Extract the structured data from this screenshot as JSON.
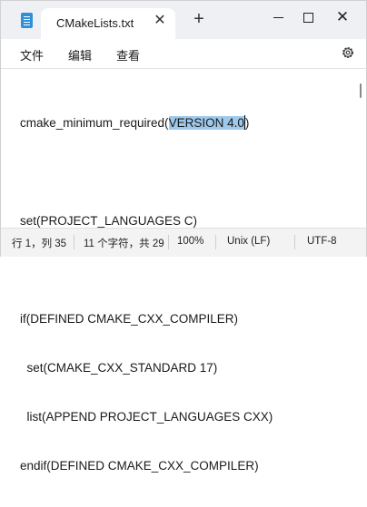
{
  "titlebar": {
    "tab_title": "CMakeLists.txt",
    "tab_close": "✕",
    "new_tab": "+",
    "close": "✕"
  },
  "menu": {
    "items": [
      "文件",
      "编辑",
      "查看"
    ]
  },
  "editor": {
    "lines": [
      {
        "pre": "cmake_minimum_required(",
        "selected": "VERSION 4.0",
        "post": ")"
      },
      {
        "text": ""
      },
      {
        "text": "set(PROJECT_LANGUAGES C)"
      },
      {
        "text": ""
      },
      {
        "text": "if(DEFINED CMAKE_CXX_COMPILER)"
      },
      {
        "text": "  set(CMAKE_CXX_STANDARD 17)"
      },
      {
        "text": "  list(APPEND PROJECT_LANGUAGES CXX)"
      },
      {
        "text": "endif(DEFINED CMAKE_CXX_COMPILER)"
      }
    ]
  },
  "status": {
    "position": "行 1，列 35",
    "selection": "11 个字符，共 29",
    "zoom": "100%",
    "line_ending": "Unix (LF)",
    "encoding": "UTF-8"
  },
  "colors": {
    "selection": "#9ec9ec",
    "titlebar": "#eef0f3",
    "statusbar": "#f3f3f3"
  },
  "icons": [
    "notepad-app-icon",
    "close-icon",
    "plus-icon",
    "minimize-icon",
    "maximize-icon",
    "gear-icon"
  ]
}
